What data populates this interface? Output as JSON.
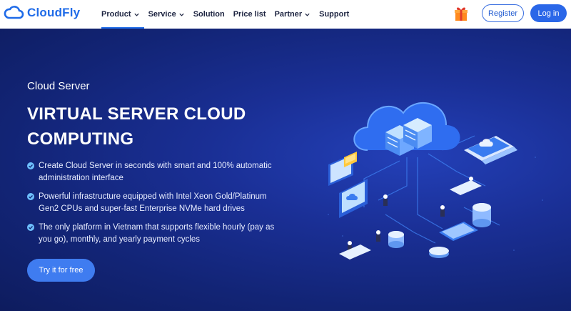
{
  "brand": {
    "name": "CloudFly",
    "color": "#1f6be8"
  },
  "nav": {
    "items": [
      {
        "label": "Product",
        "dropdown": true,
        "active": true
      },
      {
        "label": "Service",
        "dropdown": true
      },
      {
        "label": "Solution",
        "dropdown": false
      },
      {
        "label": "Price list",
        "dropdown": false
      },
      {
        "label": "Partner",
        "dropdown": true
      },
      {
        "label": "Support",
        "dropdown": false
      }
    ],
    "register_label": "Register",
    "login_label": "Log in"
  },
  "hero": {
    "subtitle": "Cloud Server",
    "title": "VIRTUAL SERVER CLOUD COMPUTING",
    "features": [
      "Create Cloud Server in seconds with smart and 100% automatic administration interface",
      "Powerful infrastructure equipped with Intel Xeon Gold/Platinum Gen2 CPUs and super-fast Enterprise NVMe hard drives",
      "The only platform in Vietnam that supports flexible hourly (pay as you go), monthly, and yearly payment cycles"
    ],
    "cta_label": "Try it for free",
    "background": "#10226e",
    "accent": "#3f7cf0"
  },
  "icons": [
    "cloud-logo-icon",
    "chevron-down-icon",
    "gift-icon",
    "check-circle-icon",
    "cloud-server-illustration"
  ]
}
